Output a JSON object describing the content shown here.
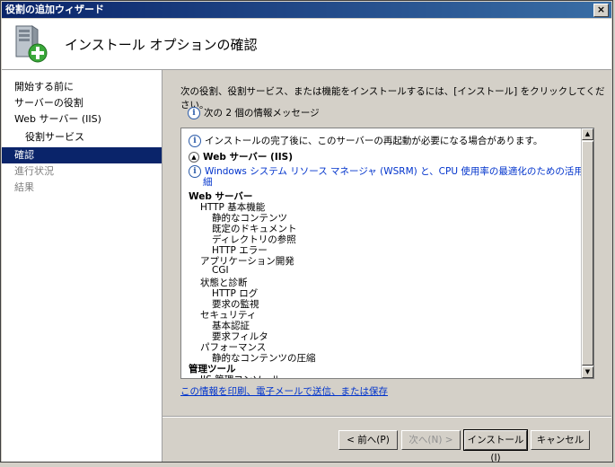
{
  "window": {
    "title": "役割の追加ウィザード",
    "close_label": "×"
  },
  "header": {
    "title": "インストール オプションの確認"
  },
  "sidebar": {
    "items": [
      {
        "label": "開始する前に",
        "state": "normal"
      },
      {
        "label": "サーバーの役割",
        "state": "normal"
      },
      {
        "label": "Web サーバー (IIS)",
        "state": "normal"
      },
      {
        "label": "役割サービス",
        "state": "indent"
      },
      {
        "label": "確認",
        "state": "active"
      },
      {
        "label": "進行状況",
        "state": "disabled"
      },
      {
        "label": "結果",
        "state": "disabled"
      }
    ]
  },
  "main": {
    "instruction": "次の役割、役割サービス、または機能をインストールするには、[インストール] をクリックしてください。",
    "message_count": "次の 2 個の情報メッセージ",
    "restart_notice": "インストールの完了後に、このサーバーの再起動が必要になる場合があります。",
    "section_title": "Web サーバー (IIS)",
    "wsrm_link_1": "Windows システム リソース マネージャ (WSRM) と、CPU 使用率の最適化のための活用方法の詳",
    "wsrm_link_2": "細",
    "tree": [
      {
        "label": "Web サーバー",
        "level": 0,
        "bold": true
      },
      {
        "label": "HTTP 基本機能",
        "level": 1
      },
      {
        "label": "静的なコンテンツ",
        "level": 2
      },
      {
        "label": "既定のドキュメント",
        "level": 2
      },
      {
        "label": "ディレクトリの参照",
        "level": 2
      },
      {
        "label": "HTTP エラー",
        "level": 2
      },
      {
        "label": "アプリケーション開発",
        "level": 1
      },
      {
        "label": "CGI",
        "level": 2
      },
      {
        "label": "状態と診断",
        "level": 1
      },
      {
        "label": "HTTP ログ",
        "level": 2
      },
      {
        "label": "要求の監視",
        "level": 2
      },
      {
        "label": "セキュリティ",
        "level": 1
      },
      {
        "label": "基本認証",
        "level": 2
      },
      {
        "label": "要求フィルタ",
        "level": 2
      },
      {
        "label": "パフォーマンス",
        "level": 1
      },
      {
        "label": "静的なコンテンツの圧縮",
        "level": 2
      },
      {
        "label": "管理ツール",
        "level": 0,
        "bold": true
      },
      {
        "label": "IIS 管理コンソール",
        "level": 1
      }
    ],
    "save_link": "この情報を印刷、電子メールで送信、または保存"
  },
  "buttons": {
    "back": "< 前へ(P)",
    "next": "次へ(N) >",
    "install": "インストール(I)",
    "cancel": "キャンセル"
  }
}
